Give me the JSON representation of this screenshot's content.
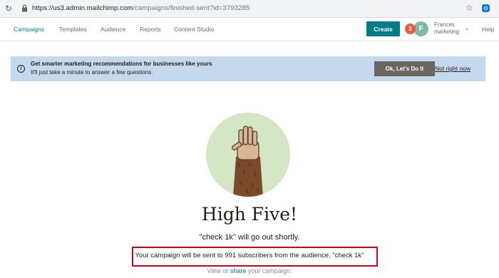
{
  "browser": {
    "url_host": "https://us3.admin.mailchimp.com",
    "url_path": "/campaigns/finished-sent?id=3793285"
  },
  "nav": {
    "items": [
      "Campaigns",
      "Templates",
      "Audience",
      "Reports",
      "Content Studio"
    ],
    "create_label": "Create",
    "notification_count": "3",
    "avatar_initial": "F",
    "user_line1": "Frances",
    "user_line2": "marketing",
    "help_label": "Help"
  },
  "banner": {
    "title": "Get smarter marketing recommendations for businesses like yours",
    "subtitle": "It'll just take a minute to answer a few questions.",
    "cta_label": "Ok, Let's Do It",
    "dismiss_label": "Not right now"
  },
  "main": {
    "headline": "High Five!",
    "subline": "\"check 1k\" will go out shortly.",
    "sent_message": "Your campaign will be sent to 991 subscribers from the audience, \"check 1k\"",
    "share_prefix": "View or ",
    "share_link": "share",
    "share_suffix": " your campaign:"
  },
  "colors": {
    "brand": "#007c89",
    "banner_bg": "#c5d9ee",
    "hero_bg": "#d4e7c5",
    "highlight": "#d0021b"
  }
}
